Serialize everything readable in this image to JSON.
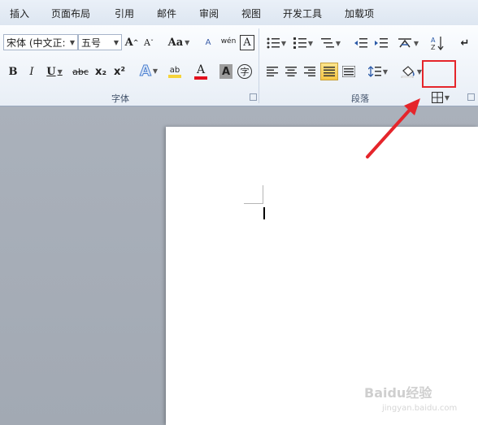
{
  "tabs": [
    "插入",
    "页面布局",
    "引用",
    "邮件",
    "审阅",
    "视图",
    "开发工具",
    "加载项"
  ],
  "font_group": {
    "label": "字体",
    "font_name": "宋体 (中文正:",
    "font_size": "五号",
    "grow_label": "A",
    "shrink_label": "A",
    "change_case_label": "Aa",
    "clear_format_label": "A",
    "bold": "B",
    "italic": "I",
    "underline": "U",
    "strike": "abc",
    "subscript": "x₂",
    "superscript": "x²",
    "text_effect_label": "A",
    "font_color_label": "A",
    "char_shading_label": "A",
    "enclose_char_label": "字",
    "highlight_label": "ab",
    "phonetic_label": "wén"
  },
  "paragraph_group": {
    "label": "段落"
  },
  "colors": {
    "highlight_yellow": "#f6d33a",
    "font_red": "#e3101e",
    "annotation_red": "#e5252b"
  },
  "watermark": {
    "text": "Baidu经验",
    "sub": "jingyan.baidu.com"
  }
}
